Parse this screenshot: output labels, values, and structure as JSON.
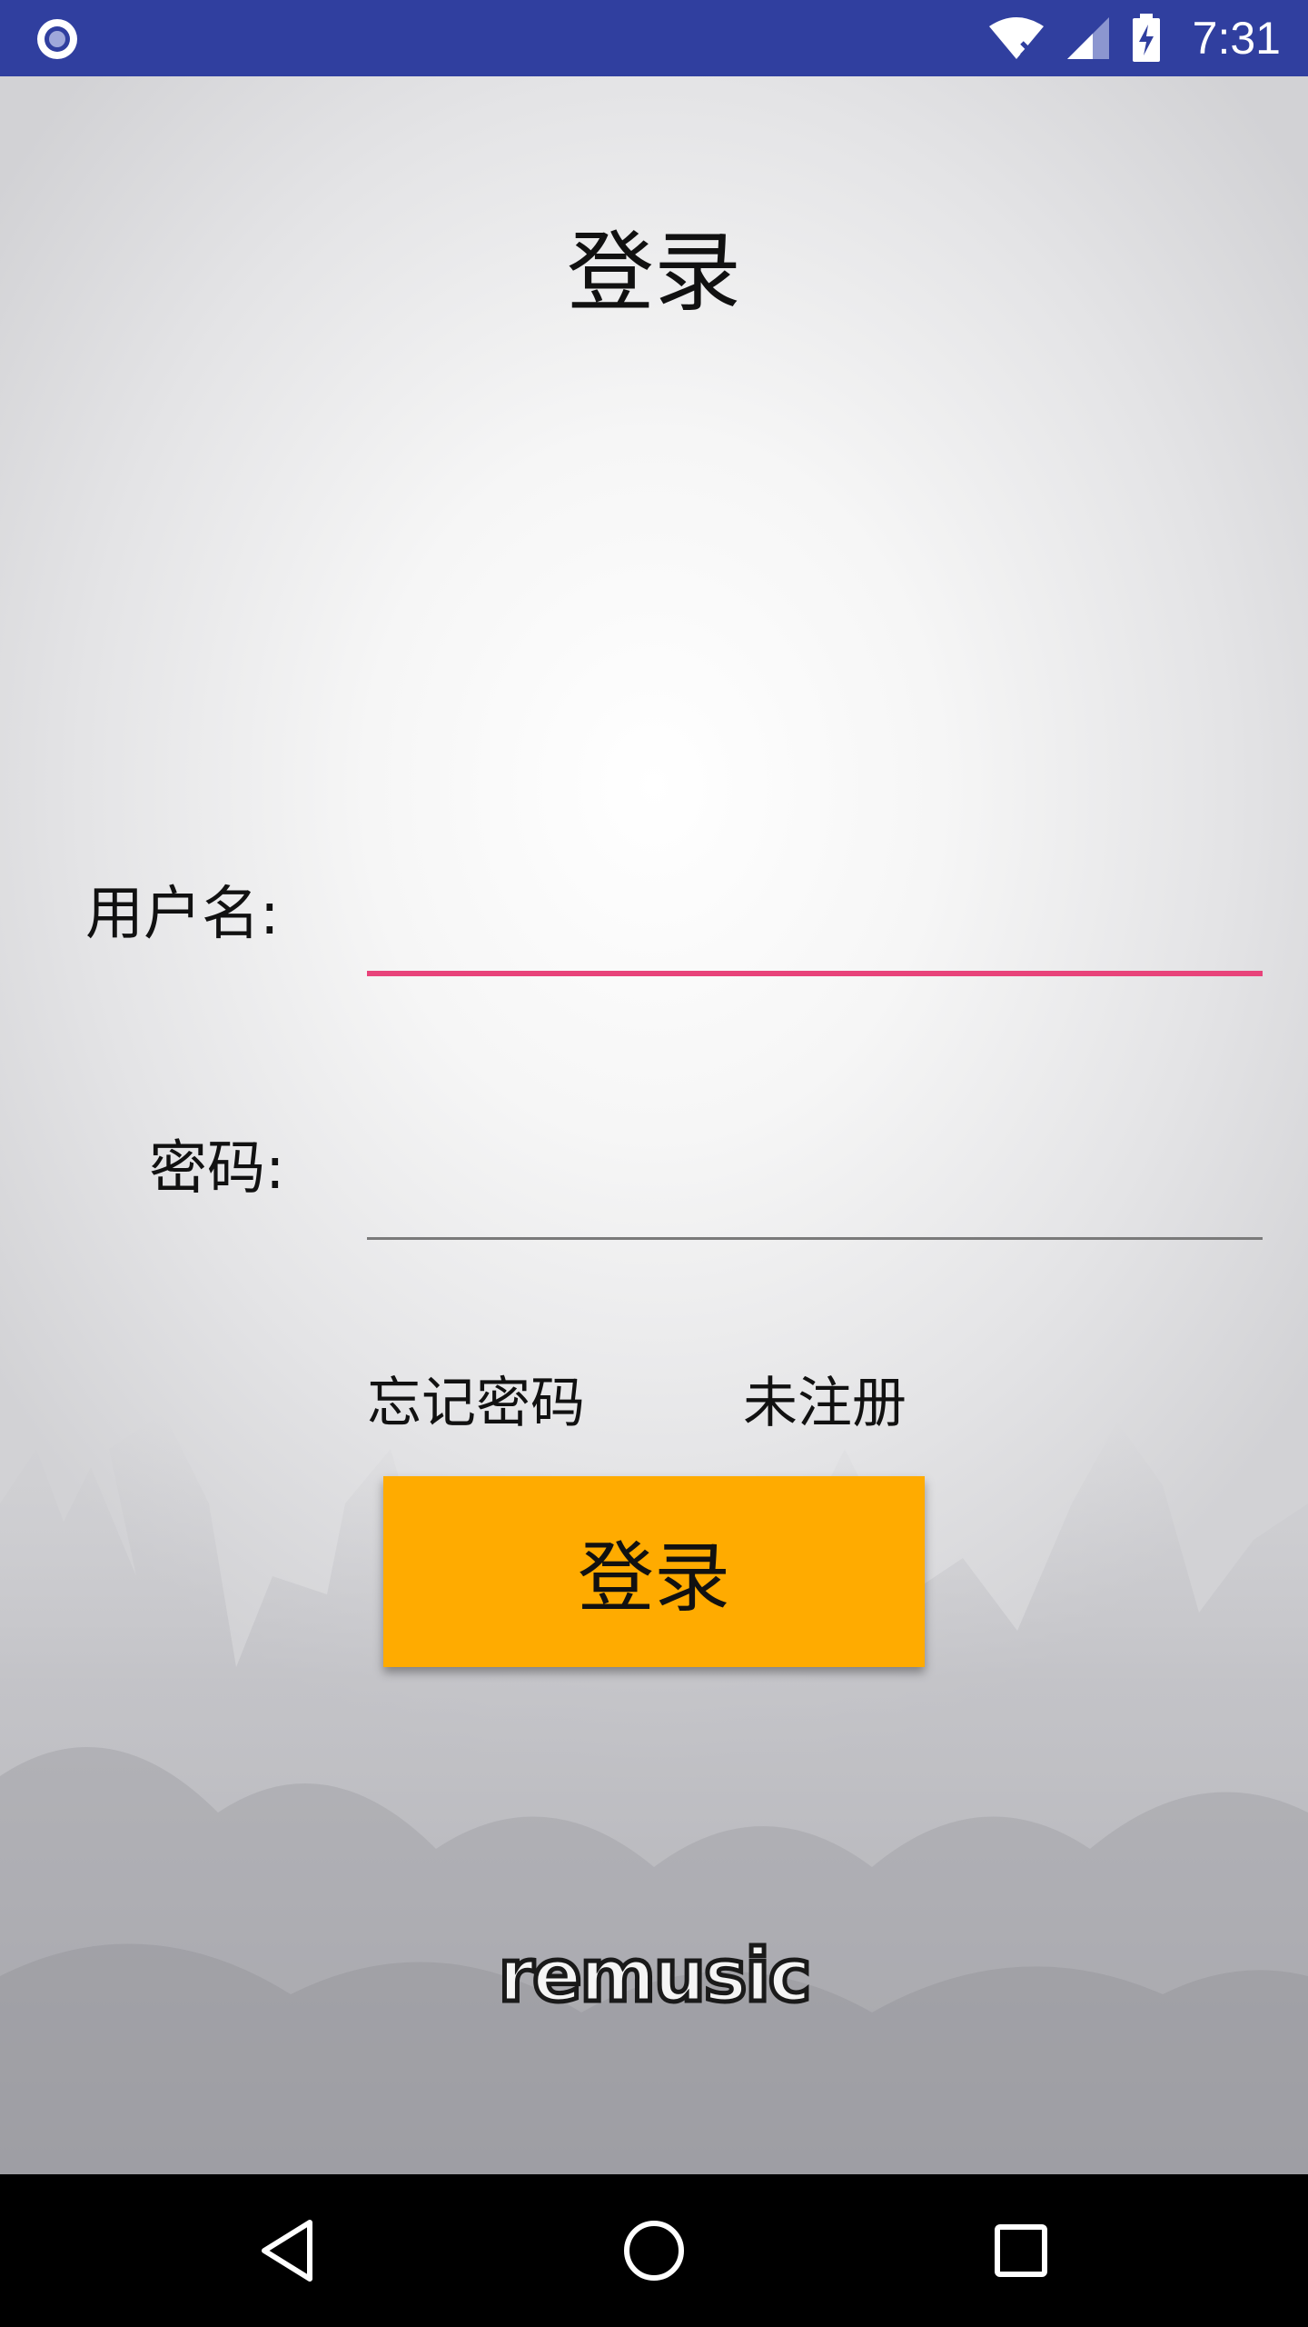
{
  "status_bar": {
    "time": "7:31",
    "icons": [
      "notification-circle-icon",
      "wifi-off-icon",
      "cell-signal-icon",
      "battery-charging-icon"
    ],
    "color": "#303f9f"
  },
  "page": {
    "title": "登录"
  },
  "form": {
    "username_label": "用户名:",
    "username_value": "",
    "password_label": "密码:",
    "password_value": "",
    "accent_color": "#e8437a"
  },
  "links": {
    "forgot_password": "忘记密码",
    "register": "未注册"
  },
  "login_button": {
    "label": "登录",
    "color": "#ffab00"
  },
  "brand": {
    "logo_text": "remusic"
  },
  "nav_bar": {
    "icons": [
      "back-icon",
      "home-icon",
      "recent-apps-icon"
    ]
  }
}
